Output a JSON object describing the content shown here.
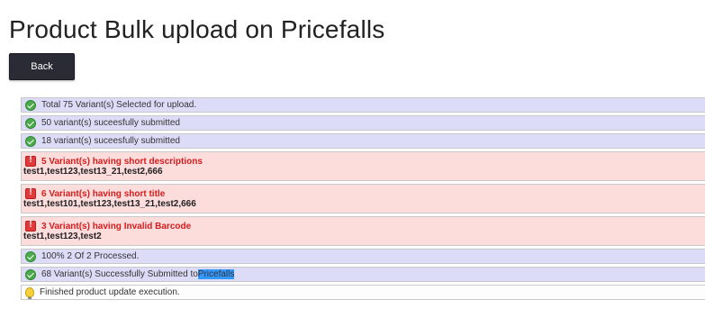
{
  "page": {
    "title": "Product Bulk upload on Pricefalls"
  },
  "toolbar": {
    "back_label": "Back"
  },
  "messages": [
    {
      "type": "success",
      "text": "Total 75 Variant(s) Selected for upload."
    },
    {
      "type": "success",
      "text": "50 variant(s) suceesfully submitted"
    },
    {
      "type": "success",
      "text": "18 variant(s) suceesfully submitted"
    },
    {
      "type": "error",
      "text": "5 Variant(s) having short descriptions",
      "detail": "test1,test123,test13_21,test2,666"
    },
    {
      "type": "error",
      "text": "6 Variant(s) having short title",
      "detail": "test1,test101,test123,test13_21,test2,666"
    },
    {
      "type": "error",
      "text": "3 Variant(s) having Invalid Barcode",
      "detail": "test1,test123,test2"
    },
    {
      "type": "success",
      "text": "100% 2 Of 2 Processed."
    },
    {
      "type": "success",
      "text": "68 Variant(s) Successfully Submitted to ",
      "highlight": "Pricefalls"
    },
    {
      "type": "info",
      "text": "Finished product update execution."
    }
  ],
  "icons": {
    "success": "check-circle-icon",
    "error": "warning-icon",
    "info": "lightbulb-icon"
  },
  "colors": {
    "success_bg": "#dcdcf8",
    "error_bg": "#fddcdc",
    "error_text": "#d41c1c",
    "button_bg": "#2b2b35",
    "selection": "#3399ff"
  }
}
